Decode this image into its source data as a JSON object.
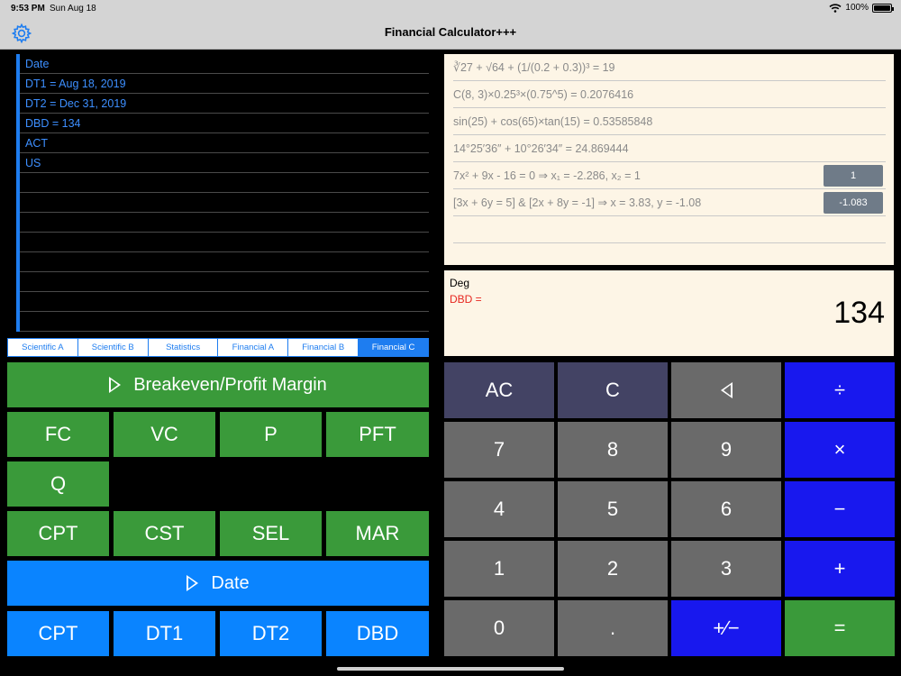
{
  "status": {
    "time": "9:53 PM",
    "date": "Sun Aug 18",
    "battery": "100%"
  },
  "nav": {
    "title": "Financial Calculator+++"
  },
  "tape": [
    "Date",
    "DT1 = Aug 18, 2019",
    "DT2 = Dec 31, 2019",
    "DBD = 134",
    "ACT",
    "US",
    "",
    "",
    "",
    "",
    "",
    "",
    "",
    ""
  ],
  "tabs": [
    "Scientific A",
    "Scientific B",
    "Statistics",
    "Financial A",
    "Financial B",
    "Financial C"
  ],
  "active_tab": "Financial C",
  "left_keys": {
    "breakeven": "Breakeven/Profit Margin",
    "fc": "FC",
    "vc": "VC",
    "p": "P",
    "pft": "PFT",
    "q": "Q",
    "cpt1": "CPT",
    "cst": "CST",
    "sel": "SEL",
    "mar": "MAR",
    "date": "Date",
    "cpt2": "CPT",
    "dt1": "DT1",
    "dt2": "DT2",
    "dbd": "DBD"
  },
  "history": {
    "row1": "∛27 + √64 + (1/(0.2 + 0.3))³ = 19",
    "row2": "C(8, 3)×0.25³×(0.75^5) = 0.2076416",
    "row3": "sin(25) + cos(65)×tan(15) = 0.53585848",
    "row4": "14°25′36″ + 10°26′34″ = 24.869444",
    "row5": "7x² + 9x - 16 = 0      ⇒      x₁ = -2.286, x₂ = 1",
    "row6": "[3x + 6y = 5]  &  [2x + 8y = -1] ⇒ x = 3.83, y = -1.08",
    "btn1": "1",
    "btn2": "-1.083"
  },
  "display": {
    "mode": "Deg",
    "label": "DBD =",
    "value": "134"
  },
  "right_keys": {
    "ac": "AC",
    "c": "C",
    "div": "÷",
    "k7": "7",
    "k8": "8",
    "k9": "9",
    "mul": "×",
    "k4": "4",
    "k5": "5",
    "k6": "6",
    "minus": "−",
    "k1": "1",
    "k2": "2",
    "k3": "3",
    "plus": "+",
    "k0": "0",
    "dot": ".",
    "pm": "+∕−",
    "eq": "="
  },
  "colors": {
    "green_key": "#3a9a3a",
    "blue_key": "#0a84ff",
    "operator_key": "#1818ee",
    "gray_key": "#6a6a6a",
    "dark_key": "#434364",
    "tape_text": "#3d8fff",
    "panel_bg": "#fdf5e6",
    "result_label": "#e6261f"
  },
  "icons": {
    "settings": "gear-icon",
    "wifi": "wifi-icon",
    "battery": "battery-icon",
    "section": "triangle-right-icon",
    "backspace": "triangle-left-icon"
  }
}
